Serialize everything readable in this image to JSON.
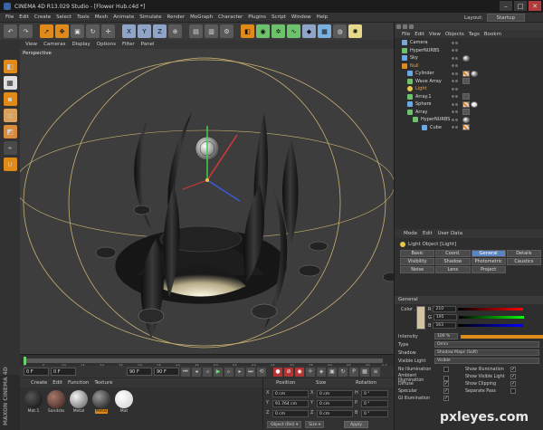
{
  "window": {
    "title": "CINEMA 4D R13.029 Studio - [Flower Hub.c4d *]",
    "minimize": "–",
    "maximize": "□",
    "close": "✕"
  },
  "menubar": {
    "items": [
      "File",
      "Edit",
      "Create",
      "Select",
      "Tools",
      "Mesh",
      "Animate",
      "Simulate",
      "Render",
      "MoGraph",
      "Character",
      "Plugins",
      "Script",
      "Window",
      "Help"
    ],
    "layout_label": "Layout:",
    "layout_value": "Startup"
  },
  "viewport": {
    "menu": [
      "View",
      "Cameras",
      "Display",
      "Options",
      "Filter",
      "Panel"
    ],
    "label": "Perspective"
  },
  "timeline": {
    "ticks": [
      "0",
      "5",
      "10",
      "15",
      "20",
      "25",
      "30",
      "35",
      "40",
      "45",
      "50",
      "55",
      "60",
      "65",
      "70",
      "75",
      "80",
      "85",
      "90"
    ],
    "end": "0 F"
  },
  "playbar": {
    "start_field": "0 F",
    "current_field": "0 F",
    "end_field": "90 F",
    "end_field2": "90 F"
  },
  "material_manager": {
    "menu": [
      "Create",
      "Edit",
      "Function",
      "Texture"
    ],
    "materials": [
      {
        "name": "Mat.1",
        "color": "#1c1c1c",
        "selected": false
      },
      {
        "name": "Sandsto",
        "color": "#5a3a2e",
        "selected": false
      },
      {
        "name": "Metal",
        "color": "#9a9a9a",
        "selected": false
      },
      {
        "name": "Metal",
        "color": "#3a3a3a",
        "selected": true
      },
      {
        "name": "Mat",
        "color": "#f2f2f2",
        "selected": false
      }
    ]
  },
  "coordinates": {
    "headers": [
      "Position",
      "Size",
      "Rotation"
    ],
    "rows": [
      {
        "axis": "X",
        "pos": "0 cm",
        "size_axis": "X",
        "size": "0 cm",
        "rot_axis": "H",
        "rot": "0 °"
      },
      {
        "axis": "Y",
        "pos": "91.764 cm",
        "size_axis": "Y",
        "size": "0 cm",
        "rot_axis": "P",
        "rot": "0 °"
      },
      {
        "axis": "Z",
        "pos": "0 cm",
        "size_axis": "Z",
        "size": "0 cm",
        "rot_axis": "B",
        "rot": "0 °"
      }
    ],
    "mode": "Object (Rel) ▾",
    "size_mode": "Size ▾",
    "apply": "Apply"
  },
  "object_manager": {
    "menu": [
      "File",
      "Edit",
      "View",
      "Objects",
      "Tags",
      "Bookm"
    ],
    "objects": [
      {
        "name": "Camera",
        "color": "#7aa7d8",
        "indent": 0,
        "tags": []
      },
      {
        "name": "HyperNURBS",
        "color": "#6cc36c",
        "indent": 0,
        "tags": []
      },
      {
        "name": "Sky",
        "color": "#6aa8e8",
        "indent": 0,
        "tags": [
          "mat"
        ]
      },
      {
        "name": "Null",
        "color": "#e08a1a",
        "indent": 0,
        "tags": []
      },
      {
        "name": "Cylinder",
        "color": "#6aa8e8",
        "indent": 1,
        "tags": [
          "chk",
          "mat"
        ]
      },
      {
        "name": "Wave Array",
        "color": "#6cc36c",
        "indent": 1,
        "tags": [
          "plain"
        ]
      },
      {
        "name": "Light",
        "color": "#e8c64a",
        "indent": 1,
        "tags": [],
        "highlight": true
      },
      {
        "name": "Array.1",
        "color": "#6cc36c",
        "indent": 1,
        "tags": [
          "plain"
        ]
      },
      {
        "name": "Sphere",
        "color": "#6aa8e8",
        "indent": 1,
        "tags": [
          "chk",
          "wmat"
        ]
      },
      {
        "name": "Array",
        "color": "#6cc36c",
        "indent": 1,
        "tags": [
          "plain"
        ]
      },
      {
        "name": "HyperNURBS",
        "color": "#6cc36c",
        "indent": 2,
        "tags": [
          "mat"
        ]
      },
      {
        "name": "Cube",
        "color": "#6aa8e8",
        "indent": 3,
        "tags": [
          "chk"
        ]
      }
    ]
  },
  "attribute_manager": {
    "menu": [
      "Mode",
      "Edit",
      "User Data"
    ],
    "title": "Light Object [Light]",
    "tabs": [
      {
        "label": "Basic",
        "active": false
      },
      {
        "label": "Coord.",
        "active": false
      },
      {
        "label": "General",
        "active": true
      },
      {
        "label": "Details",
        "active": false
      },
      {
        "label": "Visibility",
        "active": false
      },
      {
        "label": "Shadow",
        "active": false
      },
      {
        "label": "Photometric",
        "active": false
      },
      {
        "label": "Caustics",
        "active": false
      },
      {
        "label": "Noise",
        "active": false
      },
      {
        "label": "Lens",
        "active": false
      },
      {
        "label": "Project",
        "active": false
      }
    ],
    "section": "General",
    "color_label": "Color . . .",
    "color": {
      "r": "210",
      "g": "195",
      "b": "163",
      "swatch": "#d2c3a3"
    },
    "intensity_label": "Intensity",
    "intensity": "100 %",
    "intensity_fraction": 1.0,
    "type_label": "Type",
    "type": "Omni",
    "shadow_label": "Shadow",
    "shadow": "Shadow Maps (Soft)",
    "visible_light_label": "Visible Light",
    "visible_light": "Visible",
    "checkboxes_left": [
      {
        "label": "No Illumination",
        "checked": false
      },
      {
        "label": "Ambient Illumination",
        "checked": false
      },
      {
        "label": "Diffuse",
        "checked": true
      },
      {
        "label": "Specular",
        "checked": true
      },
      {
        "label": "GI Illumination",
        "checked": true
      }
    ],
    "checkboxes_right": [
      {
        "label": "Show Illumination",
        "checked": true
      },
      {
        "label": "Show Visible Light",
        "checked": true
      },
      {
        "label": "Show Clipping",
        "checked": true
      },
      {
        "label": "Separate Pass",
        "checked": false
      }
    ]
  },
  "watermark": "pxleyes.com",
  "brand_vertical": "MAXON CINEMA 4D"
}
